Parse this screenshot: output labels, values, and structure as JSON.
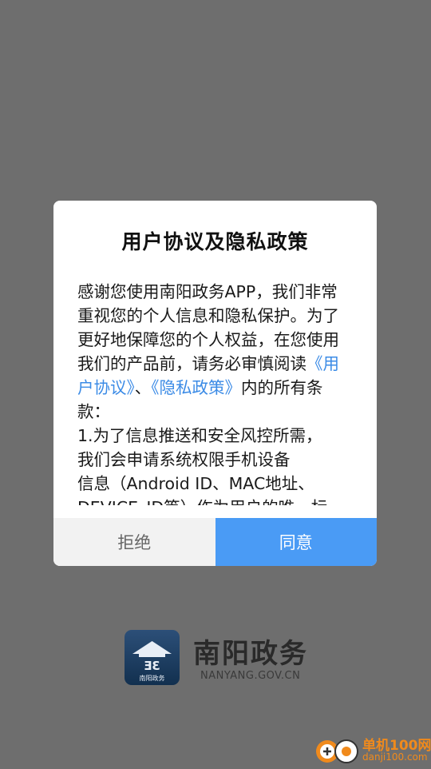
{
  "dialog": {
    "title": "用户协议及隐私政策",
    "body_intro": "感谢您使用南阳政务APP，我们非常重视您的个人信息和隐私保护。为了更好地保障您的个人权益，在您使用我们的产品前，请务必审慎阅读",
    "link_user_agreement": "《用户协议》",
    "separator": "、",
    "link_privacy_policy": "《隐私政策》",
    "body_after_links": "内的所有条款：",
    "body_item1": "1.为了信息推送和安全风控所需，\n我们会申请系统权限手机设备\n信息（Android ID、MAC地址、\nDEVICE_ID等）作为用户的唯一标",
    "reject_label": "拒绝",
    "agree_label": "同意"
  },
  "brand": {
    "name": "南阳政务",
    "url": "NANYANG.GOV.CN",
    "logo_caption": "南阳政务"
  },
  "watermark": {
    "name": "单机100网",
    "url": "danji100.com"
  },
  "colors": {
    "overlay": "#6e6e6e",
    "accent": "#4a9bf5",
    "link": "#3b8be6",
    "reject_bg": "#f2f2f2",
    "watermark": "#f08a1c"
  }
}
